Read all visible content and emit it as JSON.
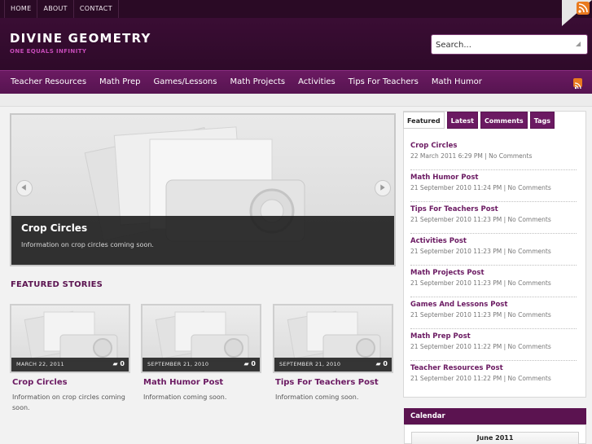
{
  "top_nav": [
    "HOME",
    "ABOUT",
    "CONTACT"
  ],
  "site": {
    "title": "DIVINE GEOMETRY",
    "tagline": "ONE EQUALS INFINITY"
  },
  "search": {
    "placeholder": "Search..."
  },
  "main_nav": [
    "Teacher Resources",
    "Math Prep",
    "Games/Lessons",
    "Math Projects",
    "Activities",
    "Tips For Teachers",
    "Math Humor"
  ],
  "slider": {
    "title": "Crop Circles",
    "text": "Information on crop circles coming soon."
  },
  "featured": {
    "heading": "FEATURED STORIES",
    "stories": [
      {
        "date": "MARCH 22, 2011",
        "comments": "0",
        "title": "Crop Circles",
        "excerpt": "Information on crop circles coming soon."
      },
      {
        "date": "SEPTEMBER 21, 2010",
        "comments": "0",
        "title": "Math Humor Post",
        "excerpt": "Information coming soon."
      },
      {
        "date": "SEPTEMBER 21, 2010",
        "comments": "0",
        "title": "Tips For Teachers Post",
        "excerpt": "Information coming soon."
      }
    ]
  },
  "sidebar": {
    "tabs": [
      "Featured",
      "Latest",
      "Comments",
      "Tags"
    ],
    "active_tab": "Featured",
    "posts": [
      {
        "title": "Crop Circles",
        "meta": "22 March 2011 6:29 PM | No Comments"
      },
      {
        "title": "Math Humor Post",
        "meta": "21 September 2010 11:24 PM | No Comments"
      },
      {
        "title": "Tips For Teachers Post",
        "meta": "21 September 2010 11:23 PM | No Comments"
      },
      {
        "title": "Activities Post",
        "meta": "21 September 2010 11:23 PM | No Comments"
      },
      {
        "title": "Math Projects Post",
        "meta": "21 September 2010 11:23 PM | No Comments"
      },
      {
        "title": "Games And Lessons Post",
        "meta": "21 September 2010 11:23 PM | No Comments"
      },
      {
        "title": "Math Prep Post",
        "meta": "21 September 2010 11:22 PM | No Comments"
      },
      {
        "title": "Teacher Resources Post",
        "meta": "21 September 2010 11:22 PM | No Comments"
      }
    ]
  },
  "calendar": {
    "title": "Calendar",
    "month": "June 2011"
  },
  "colors": {
    "header_bg": "#2e0a29",
    "nav_bg": "#6b1a62",
    "accent": "#6b1a62",
    "tagline": "#c64bb8",
    "rss": "#e97a1f"
  },
  "icons": [
    "rss-icon",
    "search-icon",
    "comment-icon",
    "arrow-left-icon",
    "arrow-right-icon",
    "camera-placeholder-icon"
  ]
}
